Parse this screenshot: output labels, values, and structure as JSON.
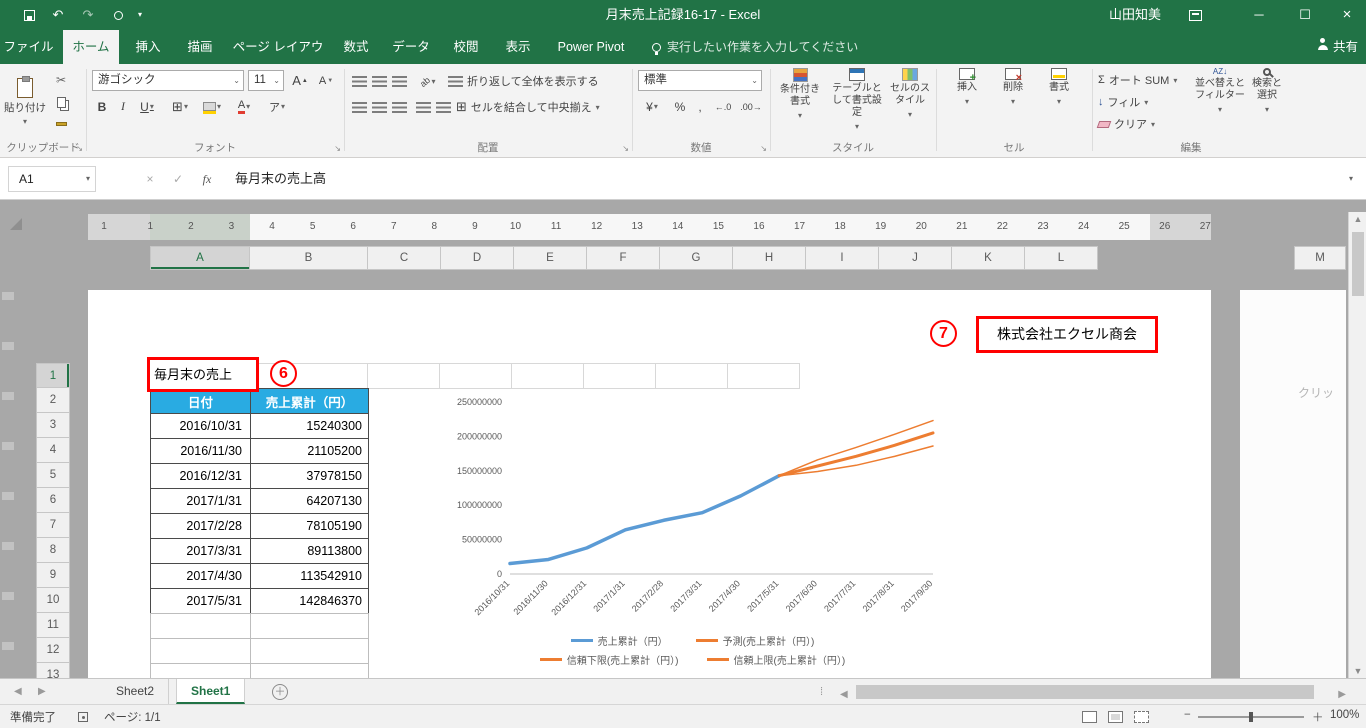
{
  "colors": {
    "excel_green": "#217346",
    "header_blue": "#29ABE2",
    "annotation_red": "#FF0000",
    "series_blue": "#5B9BD5",
    "series_orange": "#ED7D31"
  },
  "icons": {
    "undo": "↶",
    "redo": "↷",
    "dropdown": "▾",
    "dropdown_small": "⌄",
    "minimize": "─",
    "maximize": "☐",
    "close": "×",
    "cancel": "×",
    "enter": "✓",
    "fx": "fx",
    "scissors": "✂",
    "borders": "⊞",
    "sigma": "Σ",
    "fill_arrow": "↓",
    "currency": "¥",
    "percent": "%",
    "comma": ",",
    "dec_inc": "←.0",
    "dec_dec": ".00→",
    "bold": "B",
    "italic": "I",
    "underline": "U",
    "phonetic": "ア",
    "font_glyph": "A",
    "arrow_up": "▲",
    "arrow_down": "▼",
    "orient_ab": "ab",
    "sort_az": "AZ",
    "nav_left": "◀",
    "nav_right": "▶",
    "scroll_up": "▲",
    "scroll_down": "▼",
    "add_sheet": "＋",
    "minus": "−",
    "plus": "＋",
    "launcher": "↘",
    "ellipsis": "⁞"
  },
  "titlebar": {
    "title": "月末売上記録16-17  -  Excel",
    "user": "山田知美"
  },
  "ribbon_tabs": {
    "file": "ファイル",
    "home": "ホーム",
    "insert": "挿入",
    "draw": "描画",
    "page_layout": "ページ レイアウト",
    "formulas": "数式",
    "data": "データ",
    "review": "校閲",
    "view": "表示",
    "power_pivot": "Power Pivot",
    "tellme": "実行したい作業を入力してください",
    "share": "共有"
  },
  "ribbon": {
    "clipboard": {
      "label": "クリップボード",
      "paste": "貼り付け"
    },
    "font": {
      "label": "フォント",
      "name": "游ゴシック",
      "size": "11"
    },
    "alignment": {
      "label": "配置",
      "wrap": "折り返して全体を表示する",
      "merge": "セルを結合して中央揃え"
    },
    "number": {
      "label": "数値",
      "format": "標準"
    },
    "styles": {
      "label": "スタイル",
      "conditional": "条件付き書式",
      "as_table": "テーブルとして書式設定",
      "cell_styles": "セルのスタイル"
    },
    "cells": {
      "label": "セル",
      "insert": "挿入",
      "delete": "削除",
      "format": "書式"
    },
    "editing": {
      "label": "編集",
      "autosum": "オート SUM",
      "fill": "フィル",
      "clear": "クリア",
      "sort": "並べ替えとフィルター",
      "find": "検索と選択"
    }
  },
  "formula_bar": {
    "name_box": "A1",
    "value": "毎月末の売上高"
  },
  "ruler": {
    "margin_number": "1",
    "numbers": [
      "1",
      "2",
      "3",
      "4",
      "5",
      "6",
      "7",
      "8",
      "9",
      "10",
      "11",
      "12",
      "13",
      "14",
      "15",
      "16",
      "17",
      "18",
      "19",
      "20",
      "21",
      "22",
      "23",
      "24",
      "25",
      "26",
      "27"
    ]
  },
  "grid": {
    "columns": [
      "A",
      "B",
      "C",
      "D",
      "E",
      "F",
      "G",
      "H",
      "I",
      "J",
      "K",
      "L"
    ],
    "far_column": "M",
    "rows": [
      "1",
      "2",
      "3",
      "4",
      "5",
      "6",
      "7",
      "8",
      "9",
      "10",
      "11",
      "12",
      "13"
    ],
    "selected_cell": "A1"
  },
  "sheet": {
    "title_cell": "毎月末の売上",
    "annotation6": "6",
    "annotation7": "7",
    "company": "株式会社エクセル商会",
    "next_page_text": "クリッ",
    "table": {
      "headers": [
        "日付",
        "売上累計（円）"
      ],
      "rows": [
        [
          "2016/10/31",
          "15240300"
        ],
        [
          "2016/11/30",
          "21105200"
        ],
        [
          "2016/12/31",
          "37978150"
        ],
        [
          "2017/1/31",
          "64207130"
        ],
        [
          "2017/2/28",
          "78105190"
        ],
        [
          "2017/3/31",
          "89113800"
        ],
        [
          "2017/4/30",
          "113542910"
        ],
        [
          "2017/5/31",
          "142846370"
        ]
      ]
    }
  },
  "chart_data": {
    "type": "line",
    "title": "",
    "x": [
      "2016/10/31",
      "2016/11/30",
      "2016/12/31",
      "2017/1/31",
      "2017/2/28",
      "2017/3/31",
      "2017/4/30",
      "2017/5/31",
      "2017/6/30",
      "2017/7/31",
      "2017/8/31",
      "2017/9/30"
    ],
    "ylim": [
      0,
      250000000
    ],
    "yticks": [
      0,
      50000000,
      100000000,
      150000000,
      200000000,
      250000000
    ],
    "grid": false,
    "legend_position": "bottom",
    "series": [
      {
        "name": "売上累計（円）",
        "color": "#5B9BD5",
        "width": 3.5,
        "values": [
          15240300,
          21105200,
          37978150,
          64207130,
          78105190,
          89113800,
          113542910,
          142846370,
          null,
          null,
          null,
          null
        ]
      },
      {
        "name": "予測(売上累計（円）)",
        "color": "#ED7D31",
        "width": 3,
        "values": [
          null,
          null,
          null,
          null,
          null,
          null,
          null,
          142846370,
          157000000,
          171000000,
          187000000,
          205000000
        ]
      },
      {
        "name": "信頼下限(売上累計（円）)",
        "color": "#ED7D31",
        "width": 1.5,
        "values": [
          null,
          null,
          null,
          null,
          null,
          null,
          null,
          142846370,
          149000000,
          158000000,
          171000000,
          186000000
        ]
      },
      {
        "name": "信頼上限(売上累計（円）)",
        "color": "#ED7D31",
        "width": 1.5,
        "values": [
          null,
          null,
          null,
          null,
          null,
          null,
          null,
          142846370,
          166000000,
          184000000,
          203000000,
          223000000
        ]
      }
    ]
  },
  "sheet_tabs": {
    "sheet2": "Sheet2",
    "sheet1": "Sheet1",
    "active": "Sheet1"
  },
  "status_bar": {
    "ready": "準備完了",
    "page": "ページ: 1/1",
    "zoom": "100%"
  }
}
